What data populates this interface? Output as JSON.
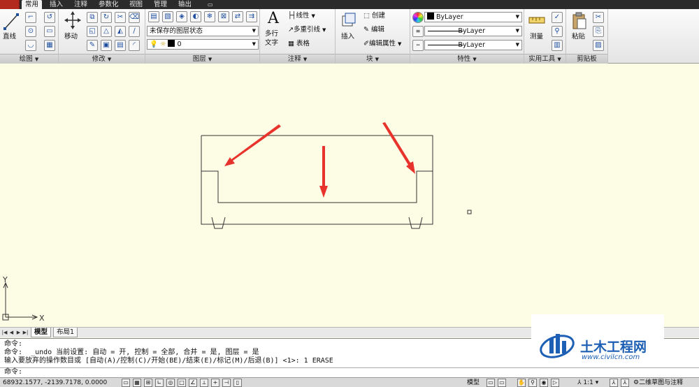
{
  "tabs": [
    {
      "label": "常用",
      "active": true
    },
    {
      "label": "插入",
      "active": false
    },
    {
      "label": "注释",
      "active": false
    },
    {
      "label": "参数化",
      "active": false
    },
    {
      "label": "视图",
      "active": false
    },
    {
      "label": "管理",
      "active": false
    },
    {
      "label": "输出",
      "active": false
    }
  ],
  "ribbon": {
    "draw": {
      "title": "绘图",
      "line_label": "直线"
    },
    "modify": {
      "title": "修改",
      "move_label": "移动"
    },
    "layers": {
      "title": "图层",
      "layer_state": "未保存的图层状态",
      "current_layer": "0"
    },
    "annotation": {
      "title": "注释",
      "text_label_1": "多行",
      "text_label_2": "文字",
      "linear_label": "线性",
      "mleader_label": "多重引线",
      "table_label": "表格"
    },
    "block": {
      "title": "块",
      "insert_label": "插入",
      "create_label": "创建",
      "edit_label": "编辑",
      "edit_attr_label": "编辑属性"
    },
    "properties": {
      "title": "特性",
      "color": "ByLayer",
      "linetype": "ByLayer",
      "lineweight": "ByLayer"
    },
    "utilities": {
      "title": "实用工具",
      "measure_label": "测量"
    },
    "clipboard": {
      "title": "剪贴板",
      "paste_label": "粘贴"
    }
  },
  "canvas": {
    "axis_x": "X",
    "axis_y": "Y",
    "annotation_color": "#e8322c"
  },
  "layout_tabs": [
    {
      "label": "模型",
      "active": true
    },
    {
      "label": "布局1",
      "active": false
    }
  ],
  "command": {
    "history": [
      "命令:",
      "命令:  _undo 当前设置: 自动 = 开, 控制 = 全部, 合并 = 是, 图层 = 是",
      "输入要放弃的操作数目或 [自动(A)/控制(C)/开始(BE)/结束(E)/标记(M)/后退(B)] <1>: 1 ERASE"
    ],
    "prompt": "命令:"
  },
  "status": {
    "coords": "68932.1577, -2139.7178, 0.0000",
    "model_label": "模型",
    "scale": "1:1",
    "workspace": "二维草图与注释"
  },
  "watermark": {
    "title": "土木工程网",
    "url": "www.civilcn.com",
    "brand_color": "#1d5fb4"
  }
}
